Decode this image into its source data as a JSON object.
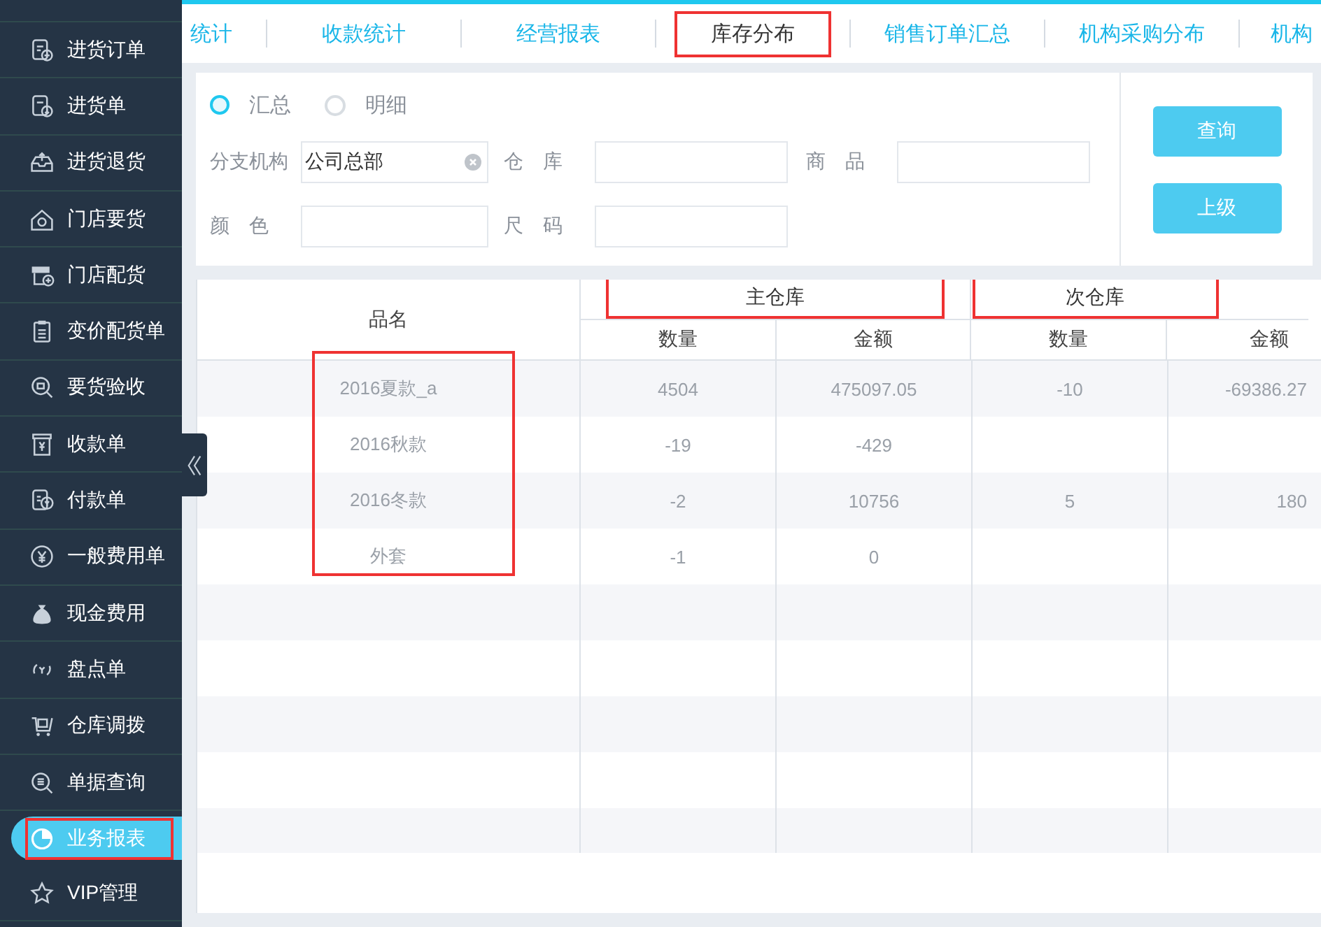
{
  "sidebar": {
    "items": [
      {
        "label": "进货订单",
        "selected": false,
        "annotated": false
      },
      {
        "label": "进货单",
        "selected": false,
        "annotated": false
      },
      {
        "label": "进货退货",
        "selected": false,
        "annotated": false
      },
      {
        "label": "门店要货",
        "selected": false,
        "annotated": false
      },
      {
        "label": "门店配货",
        "selected": false,
        "annotated": false
      },
      {
        "label": "变价配货单",
        "selected": false,
        "annotated": false
      },
      {
        "label": "要货验收",
        "selected": false,
        "annotated": false
      },
      {
        "label": "收款单",
        "selected": false,
        "annotated": false
      },
      {
        "label": "付款单",
        "selected": false,
        "annotated": false
      },
      {
        "label": "一般费用单",
        "selected": false,
        "annotated": false
      },
      {
        "label": "现金费用",
        "selected": false,
        "annotated": false
      },
      {
        "label": "盘点单",
        "selected": false,
        "annotated": false
      },
      {
        "label": "仓库调拨",
        "selected": false,
        "annotated": false
      },
      {
        "label": "单据查询",
        "selected": false,
        "annotated": false
      },
      {
        "label": "业务报表",
        "selected": true,
        "annotated": true
      },
      {
        "label": "VIP管理",
        "selected": false,
        "annotated": false
      }
    ]
  },
  "tabs": [
    {
      "label": "统计",
      "selected": false,
      "annotated": false
    },
    {
      "label": "收款统计",
      "selected": false,
      "annotated": false
    },
    {
      "label": "经营报表",
      "selected": false,
      "annotated": false
    },
    {
      "label": "库存分布",
      "selected": true,
      "annotated": true
    },
    {
      "label": "销售订单汇总",
      "selected": false,
      "annotated": false
    },
    {
      "label": "机构采购分布",
      "selected": false,
      "annotated": false
    },
    {
      "label": "机构",
      "selected": false,
      "annotated": false
    }
  ],
  "filters": {
    "modes": [
      {
        "label": "汇总",
        "selected": true
      },
      {
        "label": "明细",
        "selected": false
      }
    ],
    "fields": [
      {
        "label": "分支机构",
        "value": "公司总部",
        "clearable": true
      },
      {
        "label": "仓　库"
      },
      {
        "label": "商　品"
      },
      {
        "label": "颜　色"
      },
      {
        "label": "尺　码"
      }
    ],
    "buttons": [
      "查询",
      "上级"
    ]
  },
  "table": {
    "name_header": "品名",
    "annotate_names": true,
    "groups": [
      {
        "label": "主仓库",
        "annotated": true,
        "columns": [
          "数量",
          "金额"
        ]
      },
      {
        "label": "次仓库",
        "annotated": true,
        "columns": [
          "数量",
          "金额"
        ]
      }
    ],
    "rows": [
      [
        "2016夏款_a",
        "4504",
        "475097.05",
        "-10",
        "-69386.27"
      ],
      [
        "2016秋款",
        "-19",
        "-429",
        null,
        null
      ],
      [
        "2016冬款",
        "-2",
        "10756",
        "5",
        "180"
      ],
      [
        "外套",
        "-1",
        "0",
        null,
        null
      ]
    ]
  }
}
